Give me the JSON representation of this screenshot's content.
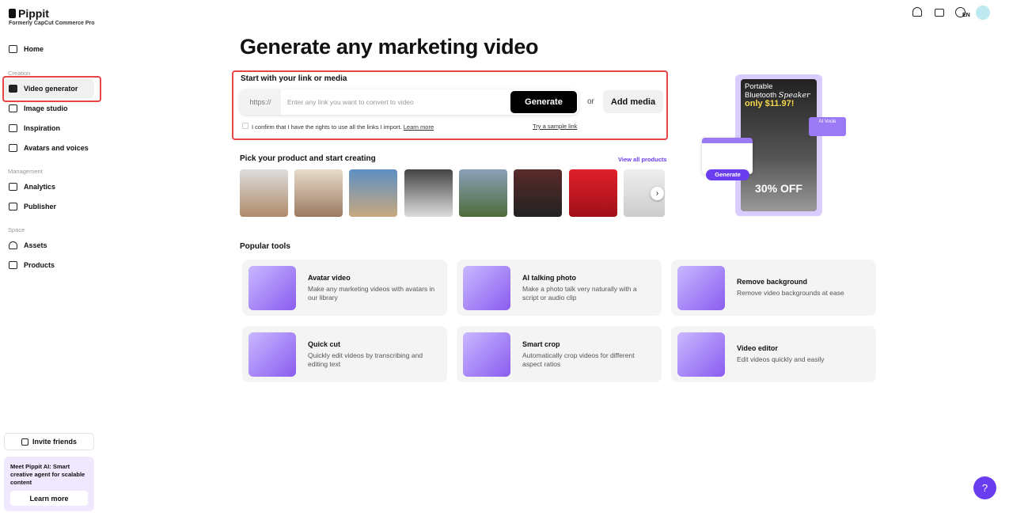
{
  "brand": {
    "name": "Pippit",
    "subtitle": "Formerly CapCut Commerce Pro"
  },
  "sidebar": {
    "home": "Home",
    "sections": [
      "Creation",
      "Management",
      "Space"
    ],
    "items": [
      "Video generator",
      "Image studio",
      "Inspiration",
      "Avatars and voices",
      "Analytics",
      "Publisher",
      "Assets",
      "Products"
    ],
    "invite": "Invite friends",
    "promo": {
      "text": "Meet Pippit AI: Smart creative agent for scalable content",
      "button": "Learn more"
    }
  },
  "topbar": {
    "lang": "EN"
  },
  "main": {
    "title": "Generate any marketing video",
    "link_heading": "Start with your link or media",
    "prefix": "https://",
    "placeholder": "Enter any link you want to convert to video",
    "generate": "Generate",
    "or": "or",
    "add_media": "Add media",
    "confirm": "I confirm that I have the rights to use all the links I import.",
    "learn_more": "Learn more",
    "sample": "Try a sample link",
    "products_heading": "Pick your product and start creating",
    "view_all": "View all products",
    "popular": "Popular tools",
    "tools": [
      {
        "title": "Avatar video",
        "desc": "Make any marketing videos with avatars in our library"
      },
      {
        "title": "AI talking photo",
        "desc": "Make a photo talk very naturally with a script or audio clip"
      },
      {
        "title": "Remove background",
        "desc": "Remove video backgrounds at ease"
      },
      {
        "title": "Quick cut",
        "desc": "Quickly edit videos by transcribing and editing text"
      },
      {
        "title": "Smart crop",
        "desc": "Automatically crop videos for different aspect ratios"
      },
      {
        "title": "Video editor",
        "desc": "Edit videos quickly and easily"
      }
    ]
  },
  "promo_banner": {
    "line1": "Portable",
    "line2": "Bluetooth",
    "line2b": "Speaker",
    "price": "only $11.97!",
    "voice": "AI Vocie",
    "generate": "Generate",
    "discount": "30% OFF"
  }
}
